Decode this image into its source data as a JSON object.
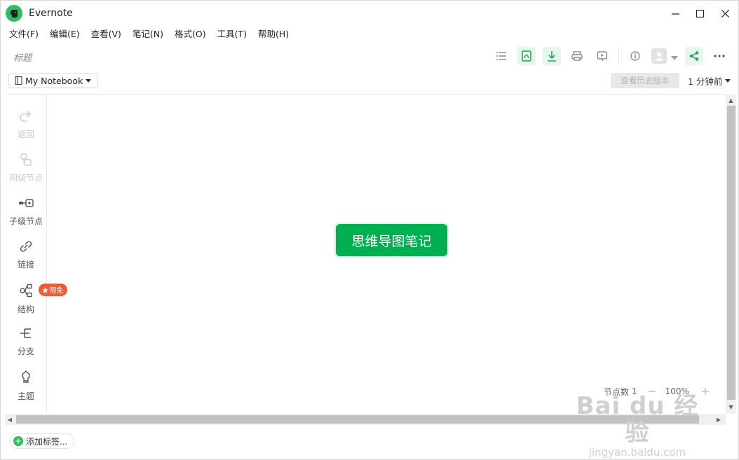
{
  "window": {
    "title": "Evernote"
  },
  "menu": [
    "文件(F)",
    "编辑(E)",
    "查看(V)",
    "笔记(N)",
    "格式(O)",
    "工具(T)",
    "帮助(H)"
  ],
  "note": {
    "title_placeholder": "标题",
    "notebook": "My Notebook",
    "history_button": "查看历史版本",
    "time_ago": "1 分钟前"
  },
  "toolbar_icons": [
    "list-icon",
    "pdf-icon",
    "download-icon",
    "print-icon",
    "present-icon",
    "info-icon",
    "user-avatar-icon",
    "share-icon",
    "more-icon"
  ],
  "side_tools": [
    {
      "label": "返回",
      "icon": "redo-icon",
      "enabled": false
    },
    {
      "label": "同级节点",
      "icon": "sibling-node-icon",
      "enabled": false
    },
    {
      "label": "子级节点",
      "icon": "child-node-icon",
      "enabled": true
    },
    {
      "label": "链接",
      "icon": "link-icon",
      "enabled": true
    },
    {
      "label": "结构",
      "icon": "structure-icon",
      "enabled": true
    },
    {
      "label": "分支",
      "icon": "branch-icon",
      "enabled": true
    },
    {
      "label": "主题",
      "icon": "theme-icon",
      "enabled": true
    }
  ],
  "promo_badge": "限免",
  "mindmap": {
    "root": "思维导图笔记"
  },
  "status": {
    "node_count_label": "节点数",
    "node_count": "1",
    "zoom": "100%"
  },
  "tags": {
    "add_label": "添加标签..."
  },
  "watermark": {
    "brand": "Bai du 经验",
    "url": "jingyan.baidu.com"
  },
  "colors": {
    "accent": "#00b050",
    "badge": "#f25a36",
    "logo": "#2dbe60"
  }
}
